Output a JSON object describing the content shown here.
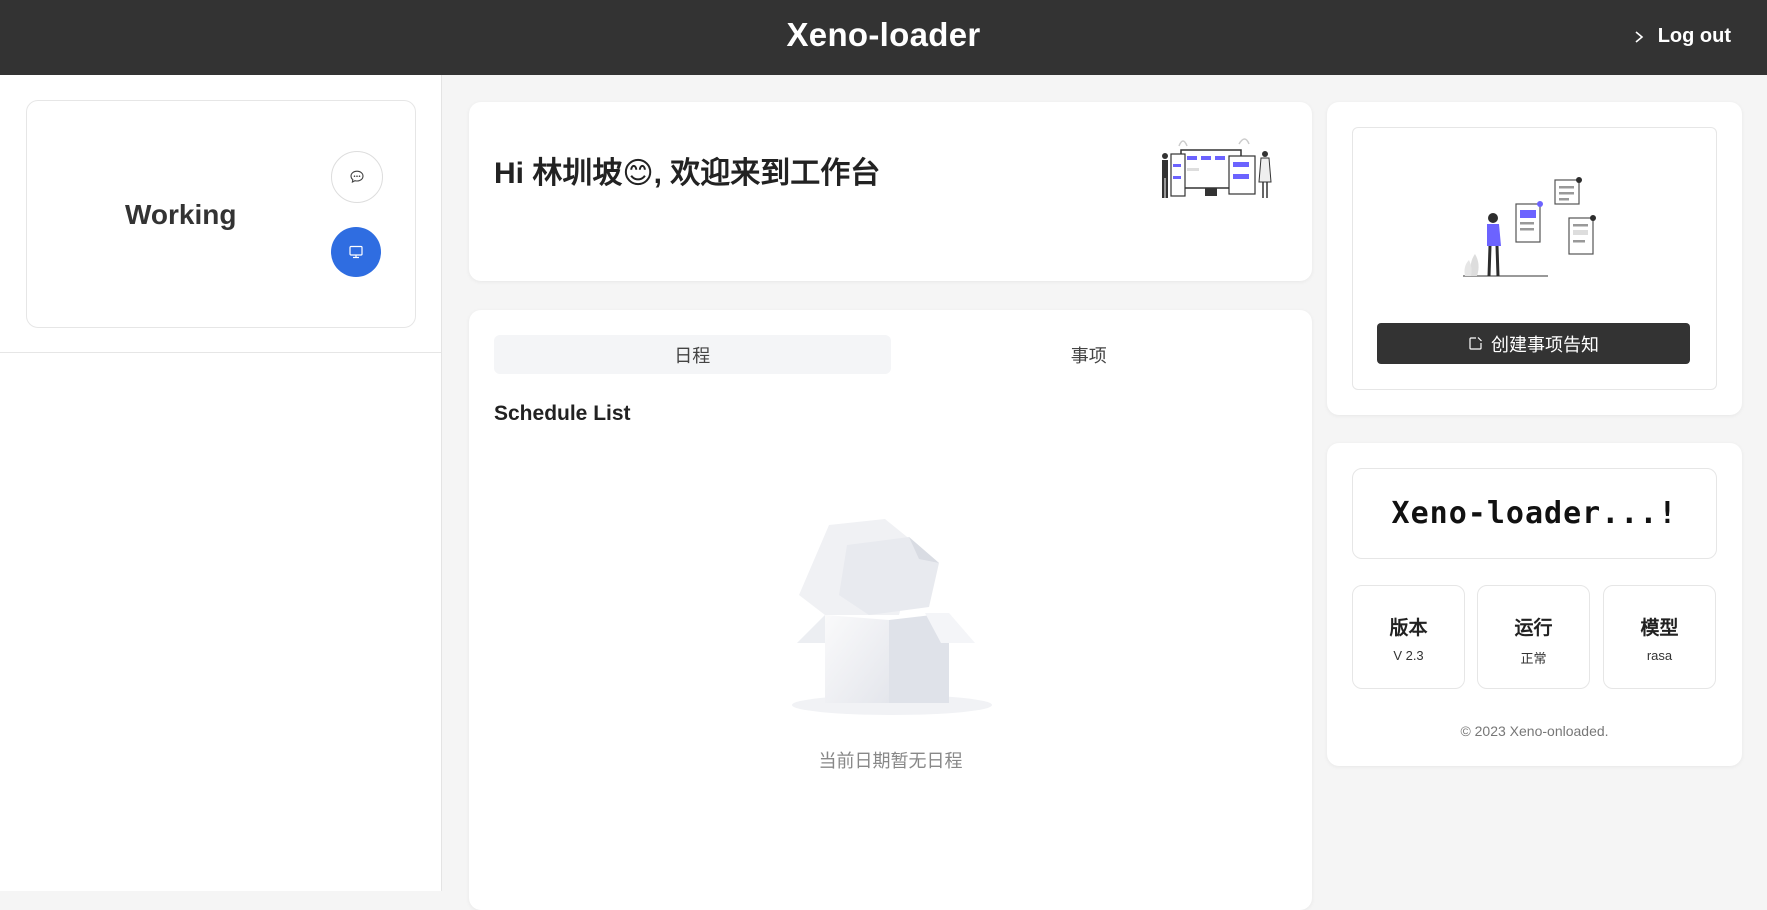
{
  "header": {
    "title": "Xeno-loader",
    "logout_label": "Log out"
  },
  "sidebar": {
    "status_label": "Working",
    "chat_icon": "chat-bubble-icon",
    "monitor_icon": "monitor-icon"
  },
  "welcome": {
    "greeting": "Hi 林圳坡😊, 欢迎来到工作台"
  },
  "schedule": {
    "tabs": [
      {
        "label": "日程",
        "active": true
      },
      {
        "label": "事项",
        "active": false
      }
    ],
    "title": "Schedule List",
    "empty_text": "当前日期暂无日程"
  },
  "notice": {
    "create_button_label": "创建事项告知",
    "create_icon": "edit-square-icon"
  },
  "info": {
    "banner_text": "Xeno-loader...!",
    "stats": [
      {
        "title": "版本",
        "value": "V 2.3"
      },
      {
        "title": "运行",
        "value": "正常"
      },
      {
        "title": "模型",
        "value": "rasa"
      }
    ],
    "footer": "© 2023 Xeno-onloaded."
  },
  "colors": {
    "topbar": "#333333",
    "accent_blue": "#2f6de1",
    "illustration_purple": "#6c63ff"
  }
}
